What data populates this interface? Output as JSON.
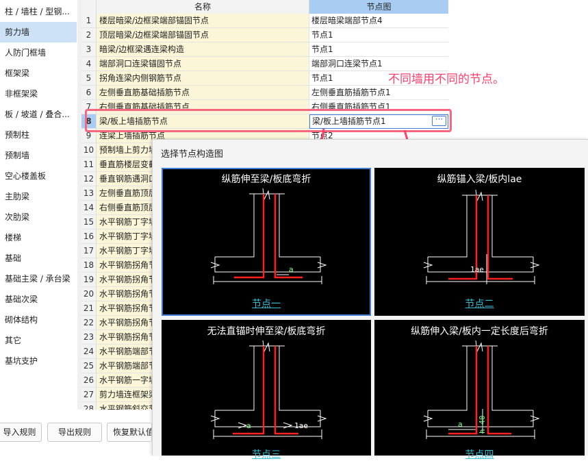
{
  "sidebar": {
    "items": [
      {
        "label": "柱 / 墙柱 / 型钢..."
      },
      {
        "label": "剪力墙"
      },
      {
        "label": "人防门框墙"
      },
      {
        "label": "框架梁"
      },
      {
        "label": "非框架梁"
      },
      {
        "label": "板 / 坡道 / 叠合..."
      },
      {
        "label": "预制柱"
      },
      {
        "label": "预制墙"
      },
      {
        "label": "空心楼盖板"
      },
      {
        "label": "主肋梁"
      },
      {
        "label": "次肋梁"
      },
      {
        "label": "楼梯"
      },
      {
        "label": "基础"
      },
      {
        "label": "基础主梁 / 承台梁"
      },
      {
        "label": "基础次梁"
      },
      {
        "label": "砌体结构"
      },
      {
        "label": "其它"
      },
      {
        "label": "基坑支护"
      }
    ],
    "active_index": 1
  },
  "table": {
    "headers": {
      "name": "名称",
      "node": "节点图"
    },
    "rows": [
      {
        "num": "1",
        "name": "楼层暗梁/边框梁端部锚固节点",
        "node": "楼层暗梁端部节点4"
      },
      {
        "num": "2",
        "name": "顶层暗梁/边框梁端部锚固节点",
        "node": "节点1"
      },
      {
        "num": "3",
        "name": "暗梁/边框梁遇连梁构造",
        "node": "节点1"
      },
      {
        "num": "4",
        "name": "端部洞口连梁锚固节点",
        "node": "端部洞口连梁节点1"
      },
      {
        "num": "5",
        "name": "拐角连梁内侧钢筋节点",
        "node": "节点1"
      },
      {
        "num": "6",
        "name": "左侧垂直筋基础插筋节点",
        "node": "左侧垂直筋插筋节点1"
      },
      {
        "num": "7",
        "name": "右侧垂直筋基础插筋节点",
        "node": "右侧垂直筋插筋节点1"
      },
      {
        "num": "8",
        "name": "梁/板上墙插筋节点",
        "node": "梁/板上墙插筋节点1"
      },
      {
        "num": "9",
        "name": "连梁上墙插筋节点",
        "node": "节点2"
      },
      {
        "num": "10",
        "name": "预制墙上剪力墙插筋节点",
        "node": ""
      },
      {
        "num": "11",
        "name": "垂直筋楼层变截面节点",
        "node": ""
      },
      {
        "num": "12",
        "name": "垂直钢筋遇洞口节点",
        "node": ""
      },
      {
        "num": "13",
        "name": "左侧垂直筋顶层节点",
        "node": ""
      },
      {
        "num": "14",
        "name": "右侧垂直筋顶层节点",
        "node": ""
      },
      {
        "num": "15",
        "name": "水平钢筋丁字墙节点",
        "node": ""
      },
      {
        "num": "16",
        "name": "水平钢筋丁字墙节点",
        "node": ""
      },
      {
        "num": "17",
        "name": "水平钢筋丁字墙节点",
        "node": ""
      },
      {
        "num": "18",
        "name": "水平钢筋拐角节点",
        "node": ""
      },
      {
        "num": "19",
        "name": "水平钢筋拐角节点",
        "node": ""
      },
      {
        "num": "20",
        "name": "水平钢筋拐角节点",
        "node": ""
      },
      {
        "num": "21",
        "name": "水平钢筋拐角节点",
        "node": ""
      },
      {
        "num": "22",
        "name": "水平钢筋拐角节点",
        "node": ""
      },
      {
        "num": "23",
        "name": "水平钢筋拐角节点",
        "node": ""
      },
      {
        "num": "24",
        "name": "水平钢筋端部节点",
        "node": ""
      },
      {
        "num": "25",
        "name": "水平钢筋端部节点",
        "node": ""
      },
      {
        "num": "26",
        "name": "水平钢筋一字墙节点",
        "node": ""
      },
      {
        "num": "27",
        "name": "剪力墙连框架梁节点",
        "node": ""
      },
      {
        "num": "28",
        "name": "水平钢筋斜交节点",
        "node": ""
      }
    ],
    "selected_row": 8
  },
  "buttons": {
    "import": "导入规则",
    "export": "导出规则",
    "restore": "恢复默认值"
  },
  "annotation": "不同墙用不同的节点。",
  "dialog": {
    "title": "选择节点构造图",
    "tiles": [
      {
        "caption": "纵筋伸至梁/板底弯折",
        "label": "节点一",
        "dim": "a"
      },
      {
        "caption": "纵筋锚入梁/板内lae",
        "label": "节点二",
        "dim": "1ae"
      },
      {
        "caption": "无法直锚时伸至梁/板底弯折",
        "label": "节点三",
        "dim": "a",
        "dim2": "1ae"
      },
      {
        "caption": "纵筋伸入梁/板内一定长度后弯折",
        "label": "节点四",
        "dim": "a",
        "dim2": "h-40"
      }
    ]
  },
  "colors": {
    "accent": "#3d7bd6",
    "annotation": "#ff3f6c",
    "header_blue": "#a9cdf2",
    "cell_yellow": "#fbf6d8"
  }
}
